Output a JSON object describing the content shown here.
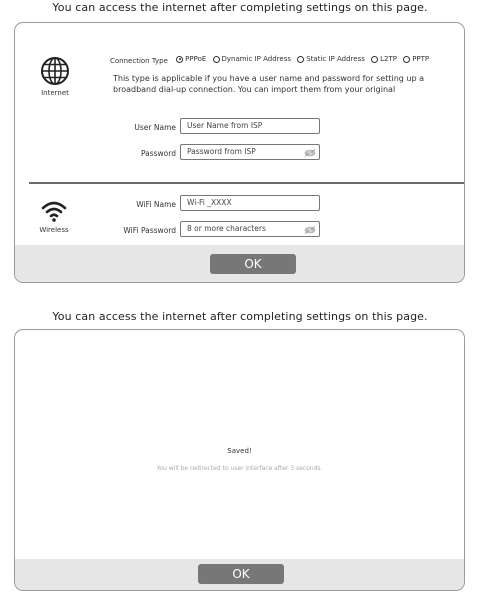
{
  "top": {
    "heading": "You can access the internet after completing settings on this page.",
    "internet": {
      "label": "Internet",
      "connection_type_label": "Connection Type",
      "options": [
        {
          "label": "PPPoE",
          "selected": true
        },
        {
          "label": "Dynamic IP Address",
          "selected": false
        },
        {
          "label": "Static IP Address",
          "selected": false
        },
        {
          "label": "L2TP",
          "selected": false
        },
        {
          "label": "PPTP",
          "selected": false
        }
      ],
      "description": "This type is applicable if you have a user name and password for setting up a broadband dial-up connection. You can import them from your original",
      "user_name_label": "User Name",
      "user_name_placeholder": "User Name from ISP",
      "password_label": "Password",
      "password_placeholder": "Password from ISP"
    },
    "wireless": {
      "label": "Wireless",
      "wifi_name_label": "WiFi Name",
      "wifi_name_value": "Wi-Fi _XXXX",
      "wifi_password_label": "WiFi Password",
      "wifi_password_placeholder": "8 or more characters"
    },
    "ok_label": "OK"
  },
  "bottom": {
    "heading": "You can access the internet after completing settings on this page.",
    "saved_text": "Saved!",
    "redirect_text": "You will be redirected to user interface after 3 seconds.",
    "ok_label": "OK"
  },
  "icons": {
    "internet": "globe-icon",
    "wireless": "wifi-icon",
    "password_toggle": "eye-icon"
  }
}
